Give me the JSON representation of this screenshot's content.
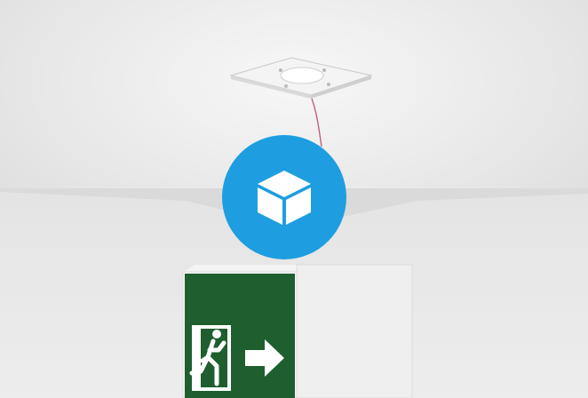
{
  "scene": {
    "description_free": true
  },
  "view3d": {
    "icon": "cube-icon",
    "color": "#1e9ee0"
  },
  "exit_sign": {
    "background_color": "#1f5e2e",
    "icons": [
      "running-person-door-icon",
      "arrow-right-icon"
    ]
  }
}
